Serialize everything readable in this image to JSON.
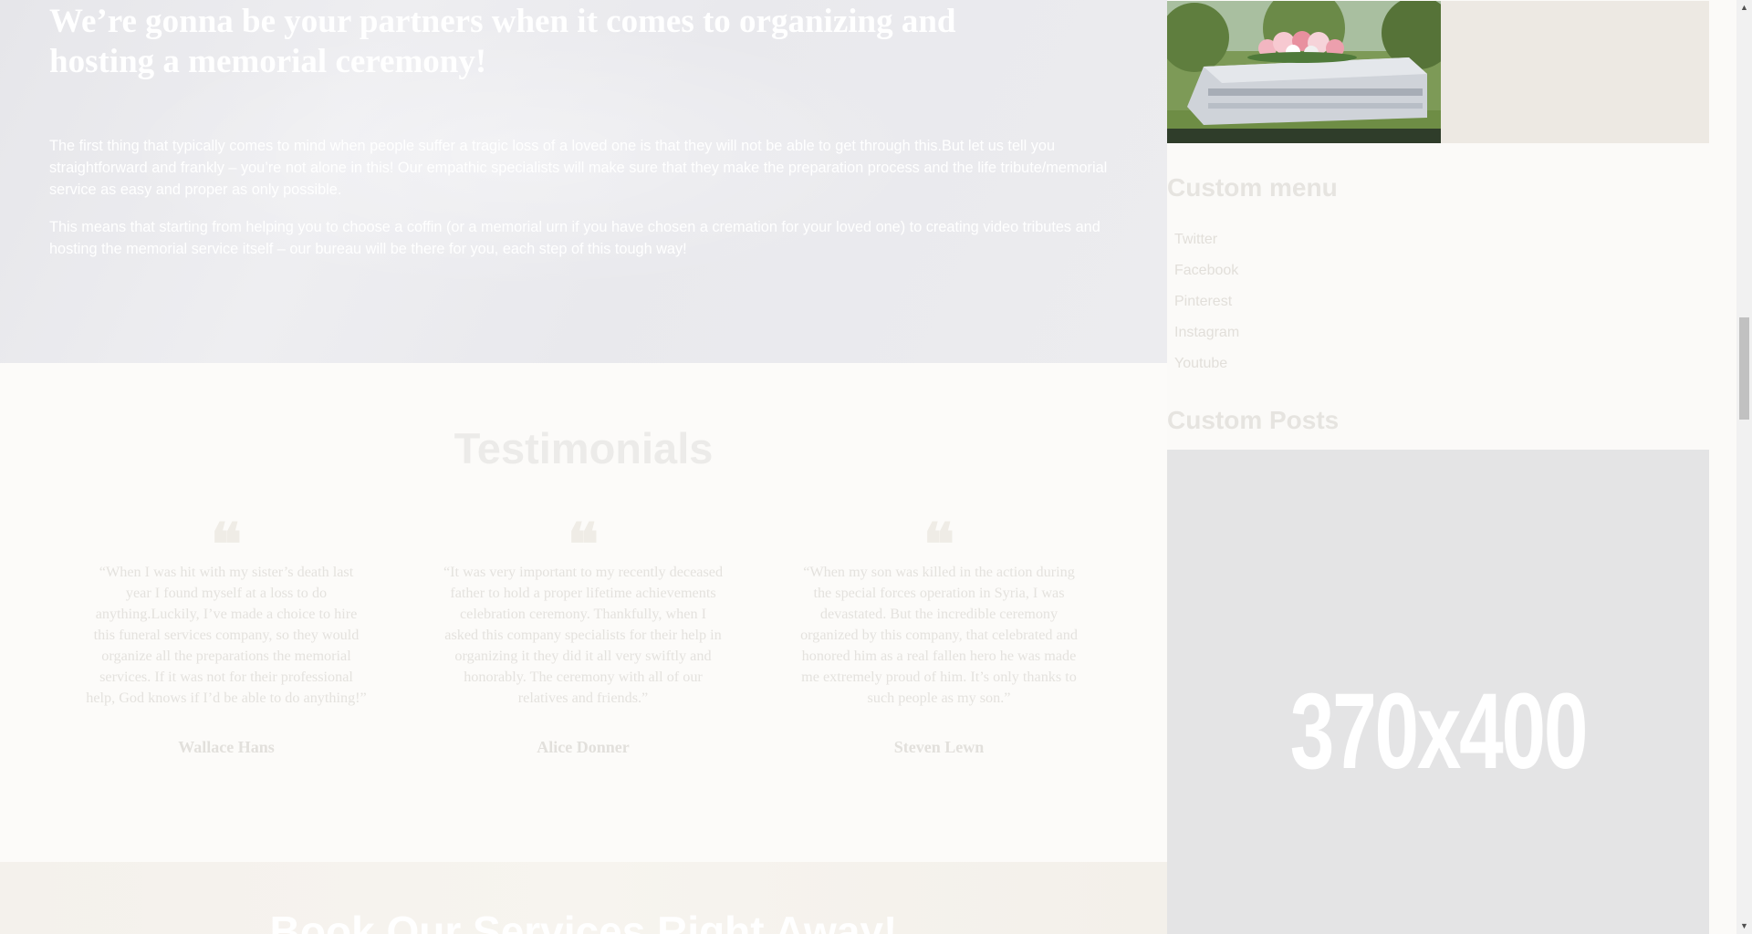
{
  "hero": {
    "title": "We’re gonna be your partners when it comes to organizing and hosting a memorial ceremony!",
    "paragraph1": "The first thing that typically comes to mind when people suffer a tragic loss of a loved one is that they will not be able to get through this.But let us tell you straightforward and frankly – you’re not alone in this! Our empathic specialists will make sure that they make the preparation process and the life tribute/memorial service as easy and proper as only possible.",
    "paragraph2": "This means that starting from helping you to choose a coffin (or a memorial urn if you have chosen a cremation for your loved one) to creating video tributes and hosting the memorial service itself – our bureau will be there for you, each step of this tough way!"
  },
  "testimonials": {
    "title": "Testimonials",
    "quote_mark": "❝",
    "items": [
      {
        "quote": "“When I was hit with my sister’s death last year I found myself at a loss to do anything.Luckily, I’ve made a choice to hire this funeral services company, so they would organize all the preparations the memorial services. If it was not for their professional help, God knows if I’d be able to do anything!”",
        "name": "Wallace Hans"
      },
      {
        "quote": "“It was very important to my recently deceased father to hold a proper lifetime achievements celebration ceremony. Thankfully, when I asked this company specialists for their help in organizing it they did it all very swiftly and honorably. The ceremony with all of our relatives and friends.”",
        "name": "Alice Donner"
      },
      {
        "quote": "“When my son was killed in the action during the special forces operation in Syria, I was devastated. But the incredible ceremony organized by this company, that celebrated and honored him as a real fallen hero he was made me extremely proud of him. It’s only thanks to such people as my son.”",
        "name": "Steven Lewn"
      }
    ]
  },
  "book": {
    "title": "Book Our Services Right Away!"
  },
  "sidebar": {
    "custom_menu_title": "Custom menu",
    "menu_items": [
      "Twitter",
      "Facebook",
      "Pinterest",
      "Instagram",
      "Youtube"
    ],
    "custom_posts_title": "Custom Posts",
    "post_placeholder_label": "370x400"
  },
  "scrollbar": {
    "up_icon": "▲",
    "down_icon": "▼",
    "position_fraction": 0.34
  },
  "colors": {
    "hero_bg": "#e9e9ed",
    "page_bg": "#fbfaf8",
    "placeholder_bg": "#e4e4e5"
  }
}
